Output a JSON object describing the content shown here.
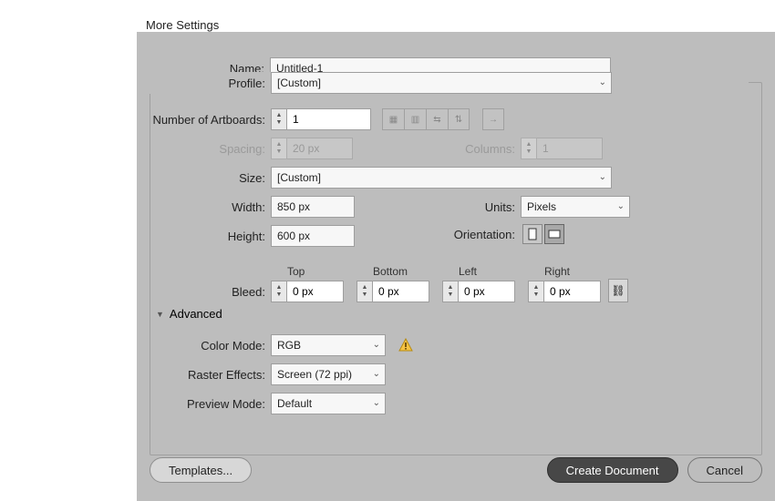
{
  "dialog_title": "More Settings",
  "name": {
    "label": "Name:",
    "value": "Untitled-1"
  },
  "profile": {
    "label": "Profile:",
    "value": "[Custom]"
  },
  "artboards": {
    "label": "Number of Artboards:",
    "value": "1",
    "spacing": {
      "label": "Spacing:",
      "value": "20 px"
    },
    "columns": {
      "label": "Columns:",
      "value": "1"
    }
  },
  "size": {
    "label": "Size:",
    "value": "[Custom]"
  },
  "width": {
    "label": "Width:",
    "value": "850 px"
  },
  "height": {
    "label": "Height:",
    "value": "600 px"
  },
  "units": {
    "label": "Units:",
    "value": "Pixels"
  },
  "orientation": {
    "label": "Orientation:"
  },
  "bleed": {
    "label": "Bleed:",
    "top": {
      "label": "Top",
      "value": "0 px"
    },
    "bottom": {
      "label": "Bottom",
      "value": "0 px"
    },
    "left": {
      "label": "Left",
      "value": "0 px"
    },
    "right": {
      "label": "Right",
      "value": "0 px"
    }
  },
  "advanced": {
    "header": "Advanced",
    "color_mode": {
      "label": "Color Mode:",
      "value": "RGB"
    },
    "raster_effects": {
      "label": "Raster Effects:",
      "value": "Screen (72 ppi)"
    },
    "preview_mode": {
      "label": "Preview Mode:",
      "value": "Default"
    }
  },
  "buttons": {
    "templates": "Templates...",
    "create": "Create Document",
    "cancel": "Cancel"
  }
}
